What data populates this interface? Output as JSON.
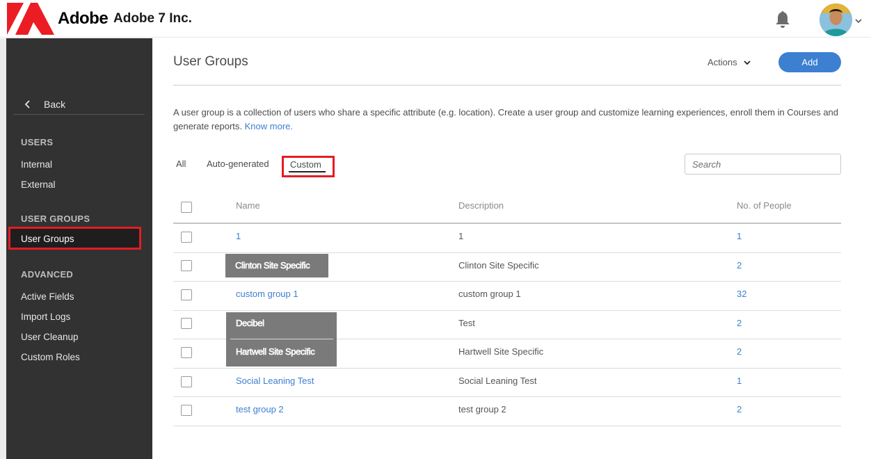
{
  "header": {
    "logo_text": "Adobe",
    "org_name": "Adobe 7 Inc."
  },
  "sidebar": {
    "back_label": "Back",
    "sections": {
      "users": {
        "heading": "USERS",
        "items": [
          "Internal",
          "External"
        ]
      },
      "user_groups": {
        "heading": "USER GROUPS",
        "items": [
          "User Groups"
        ],
        "active": "User Groups"
      },
      "advanced": {
        "heading": "ADVANCED",
        "items": [
          "Active Fields",
          "Import Logs",
          "User Cleanup",
          "Custom Roles"
        ]
      }
    }
  },
  "main": {
    "title": "User Groups",
    "actions_label": "Actions",
    "add_label": "Add",
    "description": "A user group is a collection of users who share a specific attribute (e.g. location). Create a user group and customize learning experiences, enroll them in Courses and generate reports.",
    "know_more": "Know more.",
    "tabs": [
      "All",
      "Auto-generated",
      "Custom"
    ],
    "active_tab": "Custom",
    "search_placeholder": "Search",
    "table": {
      "columns": [
        "Name",
        "Description",
        "No. of People"
      ],
      "rows": [
        {
          "name": "1",
          "description": "1",
          "people": "1"
        },
        {
          "name": "Clinton Site Specific",
          "description": "Clinton Site Specific",
          "people": "2"
        },
        {
          "name": "custom group 1",
          "description": "custom group 1",
          "people": "32"
        },
        {
          "name": "Decibel",
          "description": "Test",
          "people": "2"
        },
        {
          "name": "Hartwell Site Specific",
          "description": "Hartwell Site Specific",
          "people": "2"
        },
        {
          "name": "Social Leaning Test",
          "description": "Social Leaning Test",
          "people": "1"
        },
        {
          "name": "test group 2",
          "description": "test group 2",
          "people": "2"
        }
      ]
    }
  },
  "colors": {
    "accent": "#3d7fd1",
    "highlight_border": "#e51c23",
    "sidebar_bg": "#323232",
    "redaction": "#7a7a7a"
  }
}
